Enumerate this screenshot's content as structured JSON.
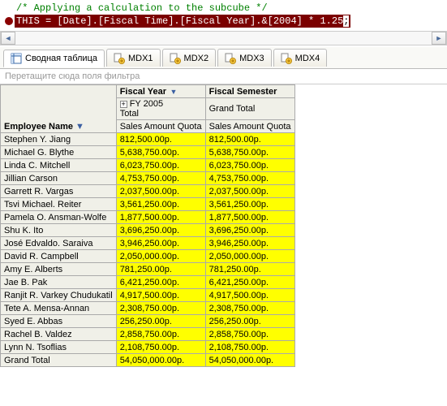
{
  "code": {
    "comment": "/* Applying a calculation to the subcube */",
    "statement": "THIS = [Date].[Fiscal Time].[Fiscal Year].&[2004] * 1.25",
    "semicolon": ";"
  },
  "tabs": {
    "pivot": "Сводная таблица",
    "mdx1": "MDX1",
    "mdx2": "MDX2",
    "mdx3": "MDX3",
    "mdx4": "MDX4"
  },
  "filter_hint": "Перетащите сюда поля фильтра",
  "headers": {
    "employee": "Employee Name",
    "fiscal_year": "Fiscal Year",
    "fiscal_semester": "Fiscal Semester",
    "fy2005": "FY 2005",
    "total": "Total",
    "grand_total_col": "Grand Total",
    "sales_quota": "Sales Amount Quota",
    "grand_total_row": "Grand Total"
  },
  "rows": [
    {
      "name": "Stephen Y. Jiang",
      "v1": "812,500.00р.",
      "v2": "812,500.00р."
    },
    {
      "name": "Michael G. Blythe",
      "v1": "5,638,750.00р.",
      "v2": "5,638,750.00р."
    },
    {
      "name": "Linda C. Mitchell",
      "v1": "6,023,750.00р.",
      "v2": "6,023,750.00р."
    },
    {
      "name": "Jillian Carson",
      "v1": "4,753,750.00р.",
      "v2": "4,753,750.00р."
    },
    {
      "name": "Garrett R. Vargas",
      "v1": "2,037,500.00р.",
      "v2": "2,037,500.00р."
    },
    {
      "name": "Tsvi Michael. Reiter",
      "v1": "3,561,250.00р.",
      "v2": "3,561,250.00р."
    },
    {
      "name": "Pamela O. Ansman-Wolfe",
      "v1": "1,877,500.00р.",
      "v2": "1,877,500.00р."
    },
    {
      "name": "Shu K. Ito",
      "v1": "3,696,250.00р.",
      "v2": "3,696,250.00р."
    },
    {
      "name": "José Edvaldo. Saraiva",
      "v1": "3,946,250.00р.",
      "v2": "3,946,250.00р."
    },
    {
      "name": "David R. Campbell",
      "v1": "2,050,000.00р.",
      "v2": "2,050,000.00р."
    },
    {
      "name": "Amy E. Alberts",
      "v1": "781,250.00р.",
      "v2": "781,250.00р."
    },
    {
      "name": "Jae B. Pak",
      "v1": "6,421,250.00р.",
      "v2": "6,421,250.00р."
    },
    {
      "name": "Ranjit R. Varkey Chudukatil",
      "v1": "4,917,500.00р.",
      "v2": "4,917,500.00р."
    },
    {
      "name": "Tete A. Mensa-Annan",
      "v1": "2,308,750.00р.",
      "v2": "2,308,750.00р."
    },
    {
      "name": "Syed E. Abbas",
      "v1": "256,250.00р.",
      "v2": "256,250.00р."
    },
    {
      "name": "Rachel B. Valdez",
      "v1": "2,858,750.00р.",
      "v2": "2,858,750.00р."
    },
    {
      "name": "Lynn N. Tsoflias",
      "v1": "2,108,750.00р.",
      "v2": "2,108,750.00р."
    }
  ],
  "grand_total": {
    "v1": "54,050,000.00р.",
    "v2": "54,050,000.00р."
  }
}
